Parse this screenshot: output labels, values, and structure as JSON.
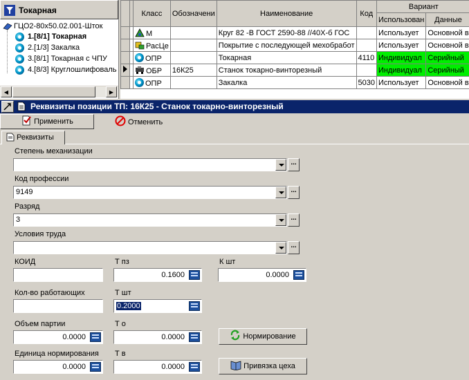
{
  "tree": {
    "header_title": "Токарная",
    "root_label": "ГЦО2-80х50.02.001-Шток",
    "items": [
      {
        "label": "1.[8/1] Токарная",
        "bold": true
      },
      {
        "label": "2.[1/3] Закалка",
        "bold": false
      },
      {
        "label": "3.[8/1] Токарная с ЧПУ",
        "bold": false
      },
      {
        "label": "4.[8/3] Круглошлифоваль",
        "bold": false
      }
    ]
  },
  "grid": {
    "headers": {
      "klass": "Класс",
      "oboznach": "Обозначени",
      "naimen": "Наименование",
      "kod": "Код",
      "variant": "Вариант",
      "ispolz": "Использован",
      "dannye": "Данные"
    },
    "rows": [
      {
        "klass": "М",
        "oboznach": "",
        "naimen": "Круг   82  -В ГОСТ 2590-88 //40Х-б ГОС",
        "kod": "",
        "ispolz": "Использует",
        "dannye": "Основной в",
        "green": false
      },
      {
        "klass": "РасЦе",
        "oboznach": "",
        "naimen": "Покрытие с  последующей мехобработ",
        "kod": "",
        "ispolz": "Использует",
        "dannye": "Основной в",
        "green": false
      },
      {
        "klass": "ОПР",
        "oboznach": "",
        "naimen": "Токарная",
        "kod": "4110",
        "ispolz": "Индивидуал",
        "dannye": "Серийный",
        "green": true
      },
      {
        "klass": "ОБР",
        "oboznach": "16К25",
        "naimen": "Станок токарно-винторезный",
        "kod": "",
        "ispolz": "Индивидуал",
        "dannye": "Серийный",
        "green": true
      },
      {
        "klass": "ОПР",
        "oboznach": "",
        "naimen": "Закалка",
        "kod": "5030",
        "ispolz": "Использует",
        "dannye": "Основной в",
        "green": false
      }
    ]
  },
  "titlebar": {
    "text": "Реквизиты позиции ТП: 16К25 - Станок токарно-винторезный"
  },
  "toolbar": {
    "apply_label": "Применить",
    "cancel_label": "Отменить"
  },
  "tab": {
    "label": "Реквизиты"
  },
  "form": {
    "mechanization_label": "Степень механизации",
    "mechanization_value": "",
    "profession_label": "Код профессии",
    "profession_value": "9149",
    "rank_label": "Разряд",
    "rank_value": "3",
    "conditions_label": "Условия труда",
    "conditions_value": "",
    "koid_label": "КОИД",
    "koid_value": "",
    "tpz_label": "Т пз",
    "tpz_value": "0.1600",
    "kpcs_label": "К шт",
    "kpcs_value": "0.0000",
    "workers_label": "Кол-во работающих",
    "workers_value": "",
    "tpcs_label": "Т шт",
    "tpcs_value": "0.2000",
    "batch_label": "Объем партии",
    "batch_value": "0.0000",
    "to_label": "Т о",
    "to_value": "0.0000",
    "unit_label": "Единица нормирования",
    "unit_value": "0.0000",
    "tv_label": "Т в",
    "tv_value": "0.0000",
    "norm_btn": "Нормирование",
    "shop_btn": "Привязка цеха"
  },
  "colors": {
    "title_bg": "#0a246a",
    "highlight_green": "#00ee00",
    "window_bg": "#d4d0c8"
  }
}
